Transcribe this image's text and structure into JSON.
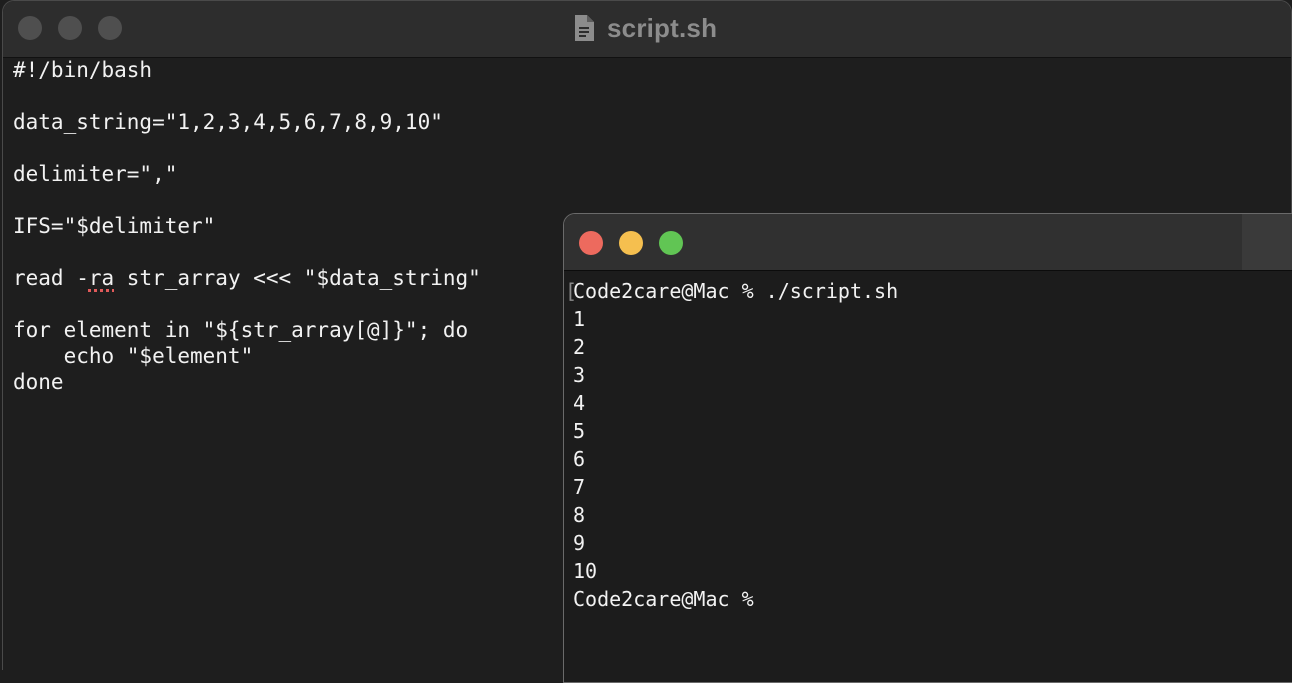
{
  "editor": {
    "title": "script.sh",
    "file_icon": "document-icon",
    "lines": [
      "#!/bin/bash",
      "",
      "data_string=\"1,2,3,4,5,6,7,8,9,10\"",
      "",
      "delimiter=\",\"",
      "",
      "IFS=\"$delimiter\"",
      "",
      "read -ra str_array <<< \"$data_string\"",
      "",
      "for element in \"${str_array[@]}\"; do",
      "    echo \"$element\"",
      "done"
    ],
    "read_line": {
      "before": "read -",
      "misspelled": "ra",
      "after": " str_array <<< \"$data_string\""
    }
  },
  "terminal": {
    "prompt_bracket": "[",
    "lines": [
      "Code2care@Mac % ./script.sh",
      "1",
      "2",
      "3",
      "4",
      "5",
      "6",
      "7",
      "8",
      "9",
      "10",
      "Code2care@Mac %"
    ],
    "colors": {
      "close": "#ed6a5e",
      "minimize": "#f5bf4f",
      "zoom": "#61c554"
    }
  }
}
